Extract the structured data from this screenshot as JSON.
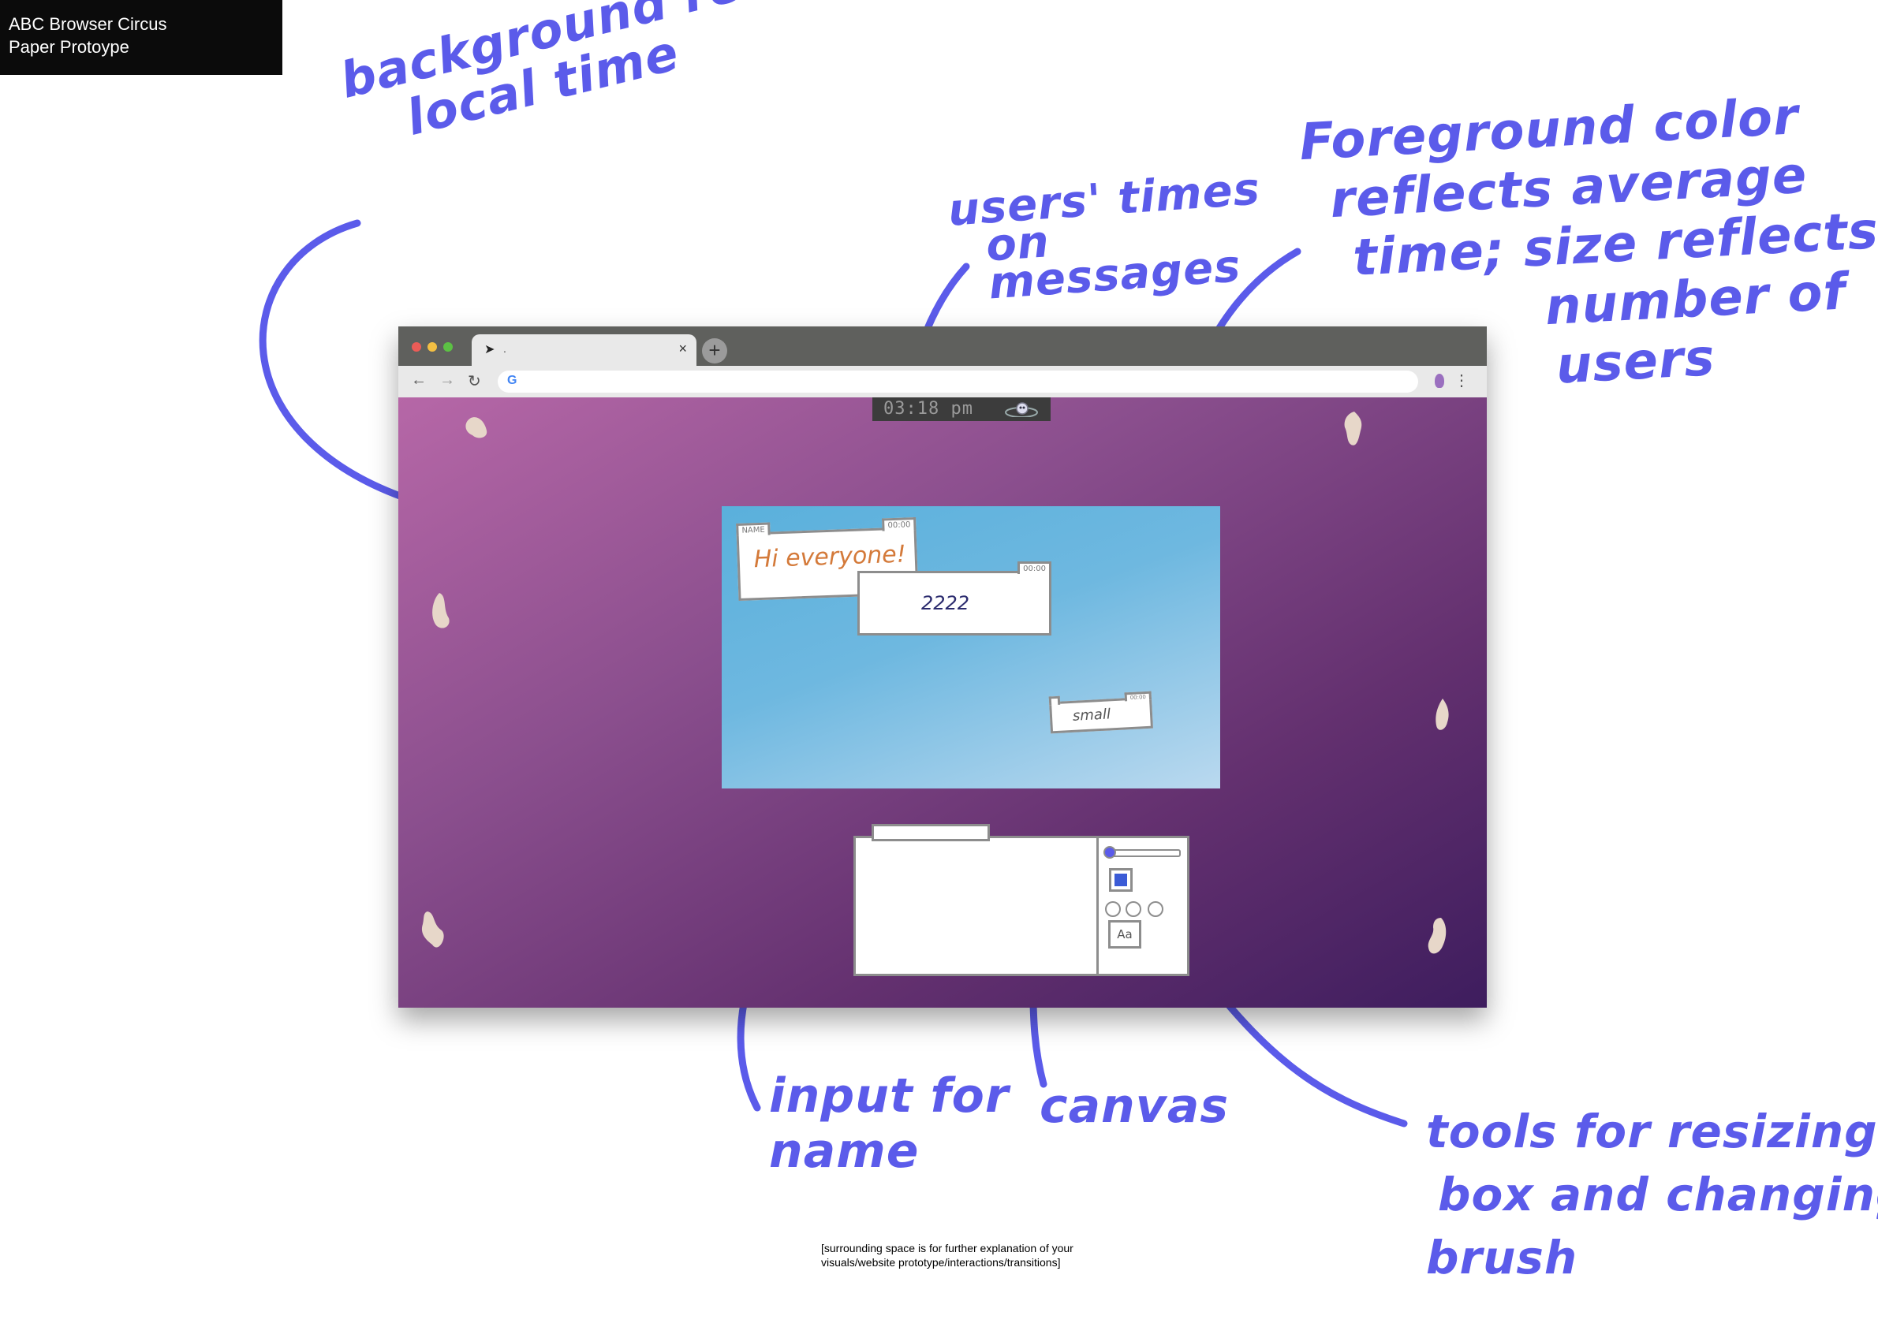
{
  "header": {
    "line1": "ABC Browser Circus",
    "line2": "Paper Protoype"
  },
  "annotations": {
    "background": [
      "background reflects",
      "local time"
    ],
    "users_times": [
      "users' times",
      "on",
      "messages"
    ],
    "foreground": [
      "Foreground color",
      "reflects average",
      "time; size reflects",
      "number of",
      "users"
    ],
    "input_name": [
      "input for",
      "name"
    ],
    "canvas": "canvas",
    "tools": [
      "tools for resizing",
      "box and changing",
      "brush"
    ]
  },
  "browser": {
    "tab": {
      "title": ".",
      "close": "×",
      "new_tab": "+"
    },
    "nav": {
      "back": "←",
      "forward": "→",
      "reload": "↻",
      "menu": "⋮"
    },
    "omnibox_icon": "G"
  },
  "page": {
    "clock_time": "03:18 pm",
    "messages": [
      {
        "name": "NAME",
        "time": "00:00",
        "text": "Hi everyone!"
      },
      {
        "name": "",
        "time": "00:00",
        "text": "2222"
      },
      {
        "name": "",
        "time": "00:00",
        "text": "small"
      }
    ],
    "composer": {
      "name_placeholder": "",
      "text_tool": "Aa"
    }
  },
  "footer": {
    "line1": "[surrounding space is for further explanation of your",
    "line2": "visuals/website prototype/interactions/transitions]"
  },
  "colors": {
    "annotation_ink": "#5b5bea",
    "background_gradient_start": "#b667a7",
    "background_gradient_end": "#3e1d5e",
    "stage_start": "#5ab0dc",
    "stage_end": "#bad9ef"
  },
  "icons": {
    "cursor": "cursor-icon",
    "google": "google-icon",
    "extension": "extension-icon",
    "clock_moon": "moon-icon"
  }
}
